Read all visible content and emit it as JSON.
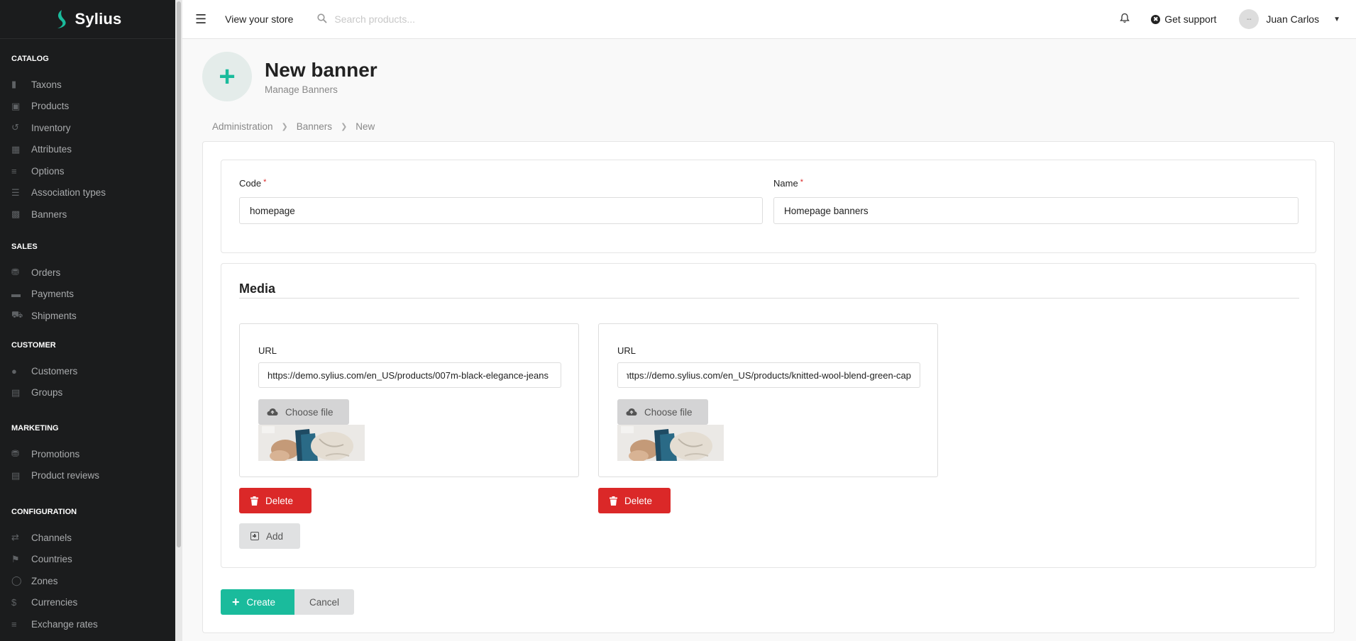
{
  "app": {
    "logo_text": "Sylius"
  },
  "sidebar": {
    "sections": [
      {
        "heading": "CATALOG",
        "items": [
          {
            "label": "Taxons",
            "icon": "folder-icon"
          },
          {
            "label": "Products",
            "icon": "cube-icon"
          },
          {
            "label": "Inventory",
            "icon": "history-icon"
          },
          {
            "label": "Attributes",
            "icon": "cubes-icon"
          },
          {
            "label": "Options",
            "icon": "options-icon"
          },
          {
            "label": "Association types",
            "icon": "list-icon"
          },
          {
            "label": "Banners",
            "icon": "image-icon"
          }
        ]
      },
      {
        "heading": "SALES",
        "items": [
          {
            "label": "Orders",
            "icon": "cart-icon"
          },
          {
            "label": "Payments",
            "icon": "credit-card-icon"
          },
          {
            "label": "Shipments",
            "icon": "truck-icon"
          }
        ]
      },
      {
        "heading": "CUSTOMER",
        "items": [
          {
            "label": "Customers",
            "icon": "users-icon"
          },
          {
            "label": "Groups",
            "icon": "archive-icon"
          }
        ]
      },
      {
        "heading": "MARKETING",
        "items": [
          {
            "label": "Promotions",
            "icon": "cart-icon"
          },
          {
            "label": "Product reviews",
            "icon": "newspaper-icon"
          }
        ]
      },
      {
        "heading": "CONFIGURATION",
        "items": [
          {
            "label": "Channels",
            "icon": "random-icon"
          },
          {
            "label": "Countries",
            "icon": "flag-icon"
          },
          {
            "label": "Zones",
            "icon": "globe-icon"
          },
          {
            "label": "Currencies",
            "icon": "dollar-icon"
          },
          {
            "label": "Exchange rates",
            "icon": "options-icon"
          }
        ]
      }
    ]
  },
  "topbar": {
    "view_store": "View your store",
    "search_placeholder": "Search products...",
    "support": "Get support",
    "user_name": "Juan Carlos",
    "avatar_text": "--"
  },
  "header": {
    "title": "New banner",
    "subtitle": "Manage Banners"
  },
  "breadcrumb": [
    "Administration",
    "Banners",
    "New"
  ],
  "form": {
    "code_label": "Code",
    "code_value": "homepage",
    "name_label": "Name",
    "name_value": "Homepage banners",
    "required_mark": "*",
    "media_title": "Media",
    "media_items": [
      {
        "url_label": "URL",
        "url_value": "https://demo.sylius.com/en_US/products/007m-black-elegance-jeans",
        "choose_label": "Choose file",
        "delete_label": "Delete"
      },
      {
        "url_label": "URL",
        "url_value": "https://demo.sylius.com/en_US/products/knitted-wool-blend-green-cap",
        "choose_label": "Choose file",
        "delete_label": "Delete"
      }
    ],
    "add_label": "Add",
    "create_label": "Create",
    "cancel_label": "Cancel"
  },
  "colors": {
    "sidebar_bg": "#1b1c1d",
    "accent": "#1abb9c",
    "danger": "#db2828",
    "neutral_button": "#e0e1e2"
  }
}
